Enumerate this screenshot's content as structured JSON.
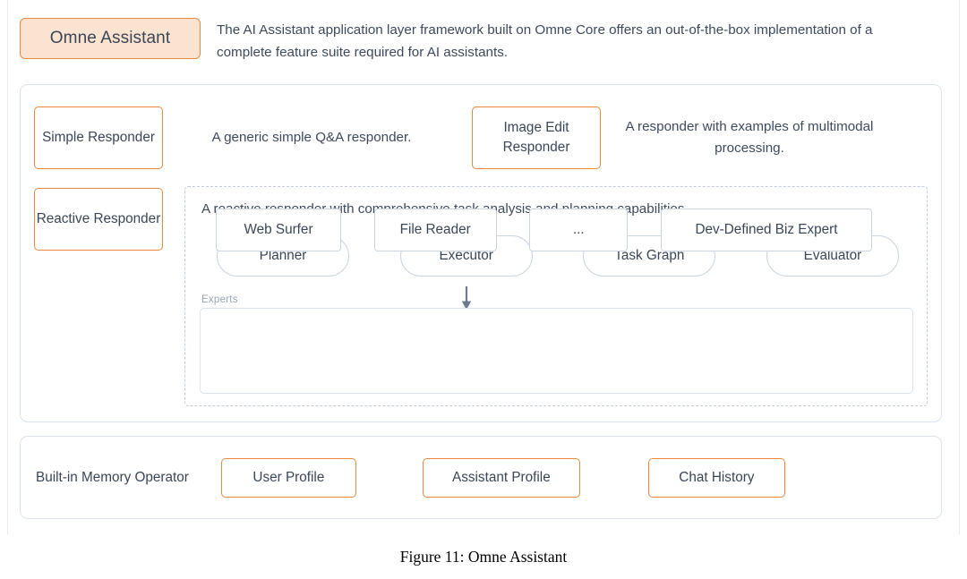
{
  "header": {
    "title_badge": "Omne Assistant",
    "description": "The AI Assistant application layer framework built on Omne Core offers an out-of-the-box implementation of a complete feature suite required for AI assistants."
  },
  "responders": [
    {
      "name": "Simple Responder",
      "description": "A generic simple Q&A responder."
    },
    {
      "name": "Image Edit Responder",
      "description": "A responder with examples of multimodal processing."
    }
  ],
  "reactive": {
    "name": "Reactive Responder",
    "description": "A reactive responder with comprehensive task analysis and planning capabilities.",
    "stages": [
      "Planner",
      "Executor",
      "Task Graph",
      "Evaluator"
    ],
    "arrow_icon": "arrow-down-icon",
    "experts_label": "Experts",
    "experts": [
      "Web Surfer",
      "File Reader",
      "...",
      "Dev-Defined Biz Expert"
    ]
  },
  "memory": {
    "label": "Built-in Memory Operator",
    "items": [
      "User Profile",
      "Assistant Profile",
      "Chat History"
    ]
  },
  "caption": "Figure 11: Omne Assistant",
  "colors": {
    "accent_orange": "#e8883f",
    "badge_fill": "#fbe3d2",
    "panel_border": "#dde3ec",
    "pill_border": "#cbd4e0",
    "dashed_border": "#c3ccda",
    "text": "#3a4656",
    "muted_text": "#97a3b4",
    "arrow": "#6b7a90"
  }
}
